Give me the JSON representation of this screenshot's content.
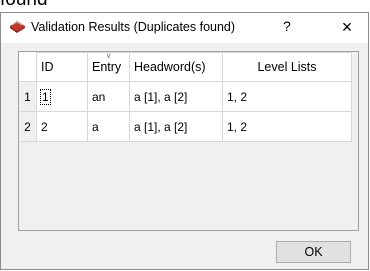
{
  "background": {
    "partial_text": "found"
  },
  "dialog": {
    "title": "Validation Results (Duplicates found)",
    "help_label": "?",
    "close_label": "×",
    "icon": "app-icon"
  },
  "table": {
    "columns": [
      "ID",
      "Entry",
      "Headword(s)",
      "Level Lists"
    ],
    "rows": [
      {
        "num": "1",
        "id": "1",
        "entry": "an",
        "headwords": "a [1], a [2]",
        "levels": "1, 2"
      },
      {
        "num": "2",
        "id": "2",
        "entry": "a",
        "headwords": "a [1], a [2]",
        "levels": "1, 2"
      }
    ]
  },
  "ok_label": "OK"
}
